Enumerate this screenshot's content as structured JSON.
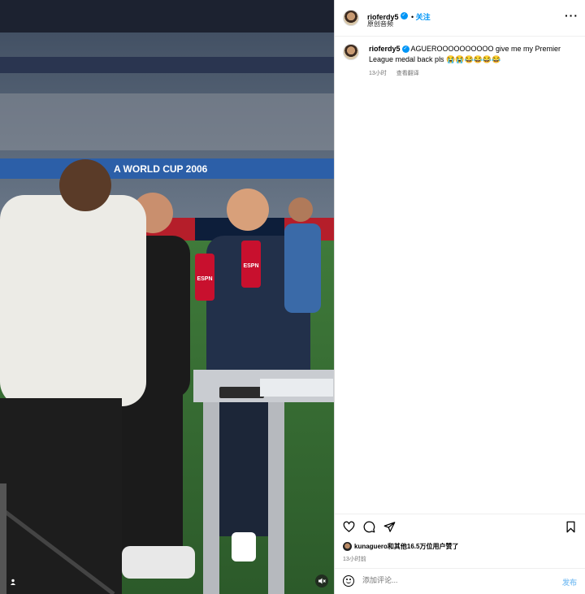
{
  "header": {
    "username": "rioferdy5",
    "follow_label": "关注",
    "audio_label": "原创音频",
    "more_label": "···"
  },
  "caption": {
    "username": "rioferdy5",
    "text": "AGUEROOOOOOOOOO give me my Premier League medal back pls 😭😭😂😂😂😂",
    "time_ago": "13小时",
    "translate_label": "查看翻译"
  },
  "media": {
    "banner_text": "A WORLD CUP 2006",
    "mic_brand": "ESPN"
  },
  "likes": {
    "text": "kunaguero和其他16.5万位用户赞了",
    "time": "13小时前"
  },
  "comment_box": {
    "placeholder": "添加评论...",
    "post_label": "发布"
  },
  "icons": {
    "like": "heart-icon",
    "comment": "comment-icon",
    "share": "share-icon",
    "save": "bookmark-icon",
    "emoji": "emoji-icon",
    "user_tag": "user-tag-icon",
    "mute": "mute-icon"
  },
  "colors": {
    "link_blue": "#0095f6",
    "post_disabled": "#8cc7f5",
    "muted_text": "#737373"
  }
}
